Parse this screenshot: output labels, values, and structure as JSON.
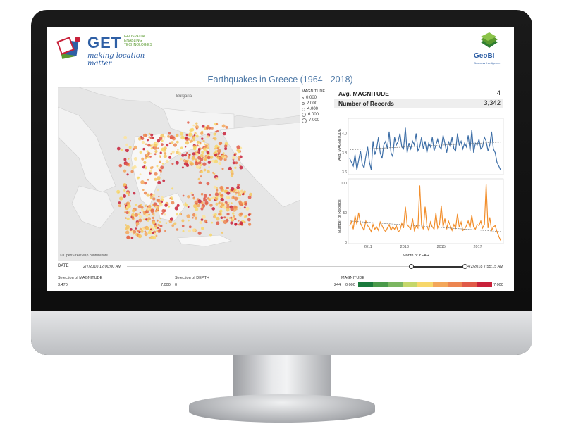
{
  "header": {
    "get_title": "GET",
    "get_subtitle": [
      "GEOSPATIAL",
      "ENABLING",
      "TECHNOLOGIES"
    ],
    "get_tagline": "making location matter",
    "geobi_title": "GeoBI",
    "geobi_subtitle": "Business Intelligence"
  },
  "dashboard_title": "Earthquakes in Greece (1964 - 2018)",
  "map": {
    "country_label": "Bulgaria",
    "attribution": "© OpenStreetMap contributors"
  },
  "legend": {
    "title": "MAGNITUDE",
    "items": [
      "0.000",
      "2.000",
      "4.000",
      "6.000",
      "7.000"
    ]
  },
  "kpis": [
    {
      "label": "Avg. MAGNITUDE",
      "value": "4"
    },
    {
      "label": "Number of Records",
      "value": "3,342"
    }
  ],
  "chart_data": [
    {
      "type": "line",
      "ylabel": "Avg. MAGNITUDE",
      "ylim": [
        3.6,
        4.1
      ],
      "yticks": [
        "4.0",
        "3.8",
        "3.6"
      ],
      "x_start": "2010-01",
      "x_end": "2018-04",
      "values": [
        3.74,
        3.7,
        3.66,
        3.78,
        3.62,
        3.72,
        3.82,
        3.68,
        3.64,
        3.76,
        3.86,
        3.7,
        3.62,
        3.92,
        3.78,
        3.84,
        3.96,
        3.8,
        3.74,
        3.88,
        3.92,
        3.84,
        4.02,
        3.8,
        3.76,
        3.96,
        3.88,
        3.92,
        4.0,
        3.86,
        3.84,
        4.06,
        3.8,
        3.9,
        3.84,
        3.92,
        3.88,
        4.0,
        3.82,
        3.86,
        3.96,
        3.84,
        3.92,
        3.8,
        3.9,
        3.86,
        3.96,
        3.82,
        3.88,
        3.94,
        3.86,
        3.84,
        3.98,
        3.9,
        3.8,
        3.92,
        3.86,
        3.96,
        3.84,
        3.82,
        4.0,
        3.88,
        3.92,
        3.84,
        3.9,
        3.86,
        3.98,
        3.82,
        4.04,
        3.8,
        3.9,
        3.88,
        3.94,
        3.84,
        3.86,
        3.96,
        3.92,
        3.82,
        3.88,
        4.02,
        3.84,
        3.8,
        3.7,
        3.66,
        3.62
      ],
      "trend": [
        3.83,
        3.91
      ],
      "color": "#3e6fa7"
    },
    {
      "type": "line",
      "xlabel": "Month of YEAR",
      "ylabel": "Number of Records",
      "ylim": [
        0,
        100
      ],
      "yticks": [
        "100",
        "50",
        "0"
      ],
      "xticks": [
        "2011",
        "2013",
        "2015",
        "2017"
      ],
      "x_start": "2010-01",
      "x_end": "2018-04",
      "values": [
        28,
        35,
        22,
        45,
        30,
        50,
        32,
        26,
        20,
        36,
        28,
        24,
        18,
        30,
        22,
        26,
        20,
        34,
        28,
        22,
        18,
        24,
        30,
        20,
        26,
        22,
        28,
        18,
        20,
        32,
        24,
        60,
        30,
        26,
        22,
        40,
        20,
        28,
        24,
        96,
        30,
        22,
        60,
        28,
        20,
        34,
        26,
        22,
        50,
        24,
        30,
        62,
        26,
        40,
        22,
        36,
        28,
        20,
        30,
        24,
        48,
        26,
        34,
        20,
        22,
        28,
        36,
        24,
        46,
        26,
        22,
        30,
        28,
        36,
        24,
        30,
        98,
        24,
        42,
        20,
        26,
        28,
        18,
        10,
        3
      ],
      "trend": [
        36,
        18
      ],
      "color": "#f28e2b"
    }
  ],
  "controls": {
    "date_label": "DATE",
    "date_start": "2/7/2010 12:00:00 AM",
    "date_end": "4/2/2018 7:55:15 AM",
    "magnitude_filter_label": "Selection of MAGNITUDE",
    "magnitude_min": "3.470",
    "magnitude_max": "7.000",
    "depth_filter_label": "Selection of DEPTH",
    "depth_min": "0",
    "depth_max_partial": "244",
    "magnitude_scale_label": "MAGNITUDE",
    "magnitude_scale_min": "0.000",
    "magnitude_scale_max": "7.000",
    "scale_colors": [
      "#1a7a3c",
      "#4a9a4a",
      "#7bb661",
      "#c5d76a",
      "#f7d76a",
      "#f3a75a",
      "#ec8550",
      "#e05a48",
      "#c8213a"
    ]
  }
}
